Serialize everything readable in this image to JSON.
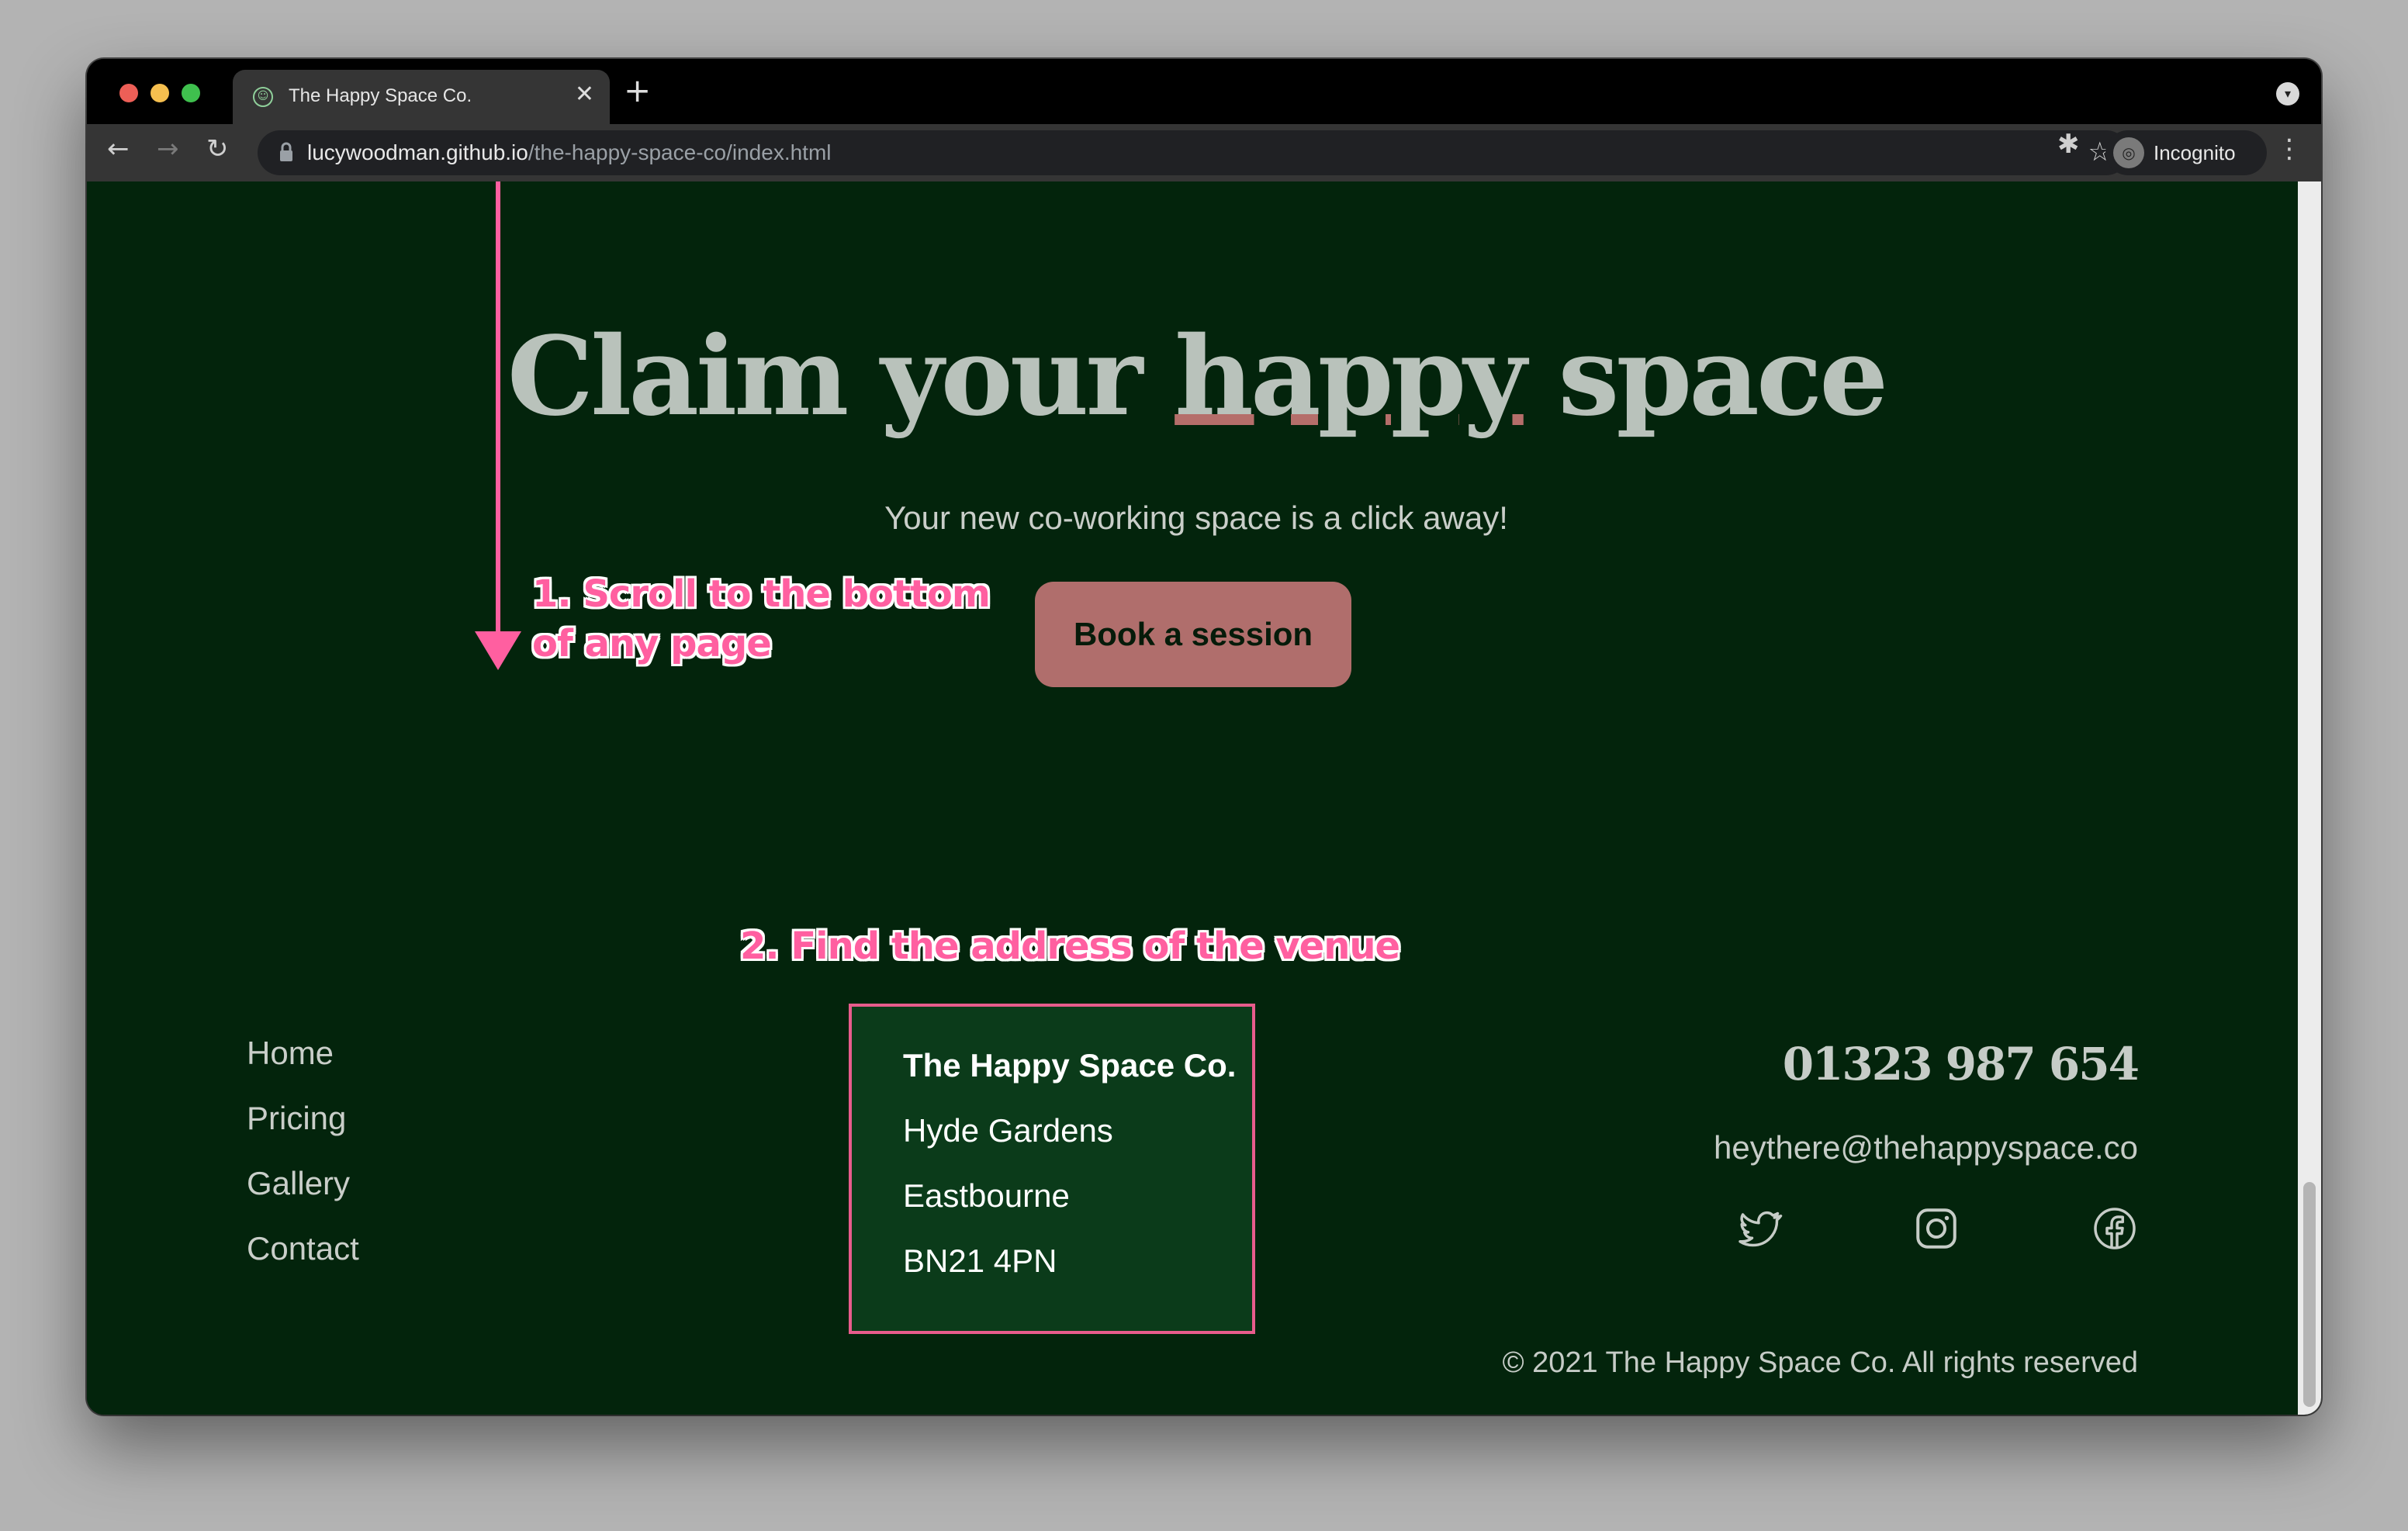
{
  "browser": {
    "tab_title": "The Happy Space Co.",
    "tab_close": "✕",
    "new_tab": "+",
    "url_host": "lucywoodman.github.io",
    "url_path": "/the-happy-space-co/index.html",
    "profile_label": "Incognito",
    "nav": {
      "back": "←",
      "forward": "→",
      "reload": "↻"
    },
    "star": "☆",
    "extensions": "✱",
    "menu": "⋮"
  },
  "hero": {
    "title_before": "Claim your ",
    "title_highlight": "happy",
    "title_after": " space",
    "subtitle": "Your new co-working space is a click away!",
    "cta_label": "Book a session"
  },
  "annotations": {
    "step1_line1": "1. Scroll to the bottom",
    "step1_line2": "of any page",
    "step2": "2. Find the address of the venue"
  },
  "footer": {
    "nav": [
      "Home",
      "Pricing",
      "Gallery",
      "Contact"
    ],
    "address": {
      "name": "The Happy Space Co.",
      "line1": "Hyde Gardens",
      "line2": "Eastbourne",
      "line3": "BN21 4PN"
    },
    "phone": "01323 987 654",
    "email": "heythere@thehappyspace.co",
    "social_icons": [
      "twitter-icon",
      "instagram-icon",
      "facebook-icon"
    ],
    "copyright": "© 2021 The Happy Space Co. All rights reserved"
  },
  "colors": {
    "page_bg": "#03240c",
    "accent": "#b06e6c",
    "annotation": "#ff5fa0",
    "address_box_bg": "#0b3b1a"
  }
}
